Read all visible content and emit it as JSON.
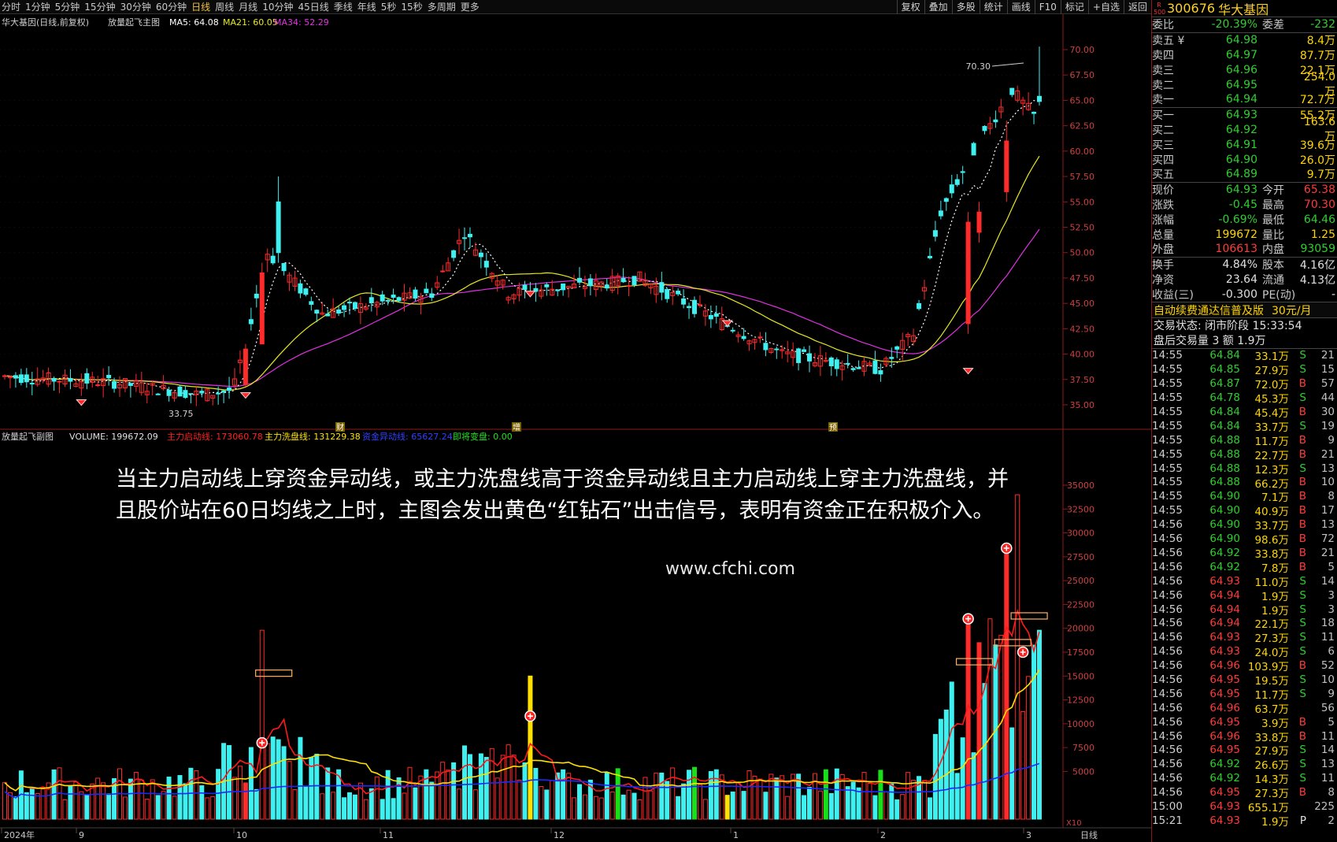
{
  "toolbar": {
    "periods": [
      "分时",
      "1分钟",
      "5分钟",
      "15分钟",
      "30分钟",
      "60分钟",
      "日线",
      "周线",
      "月线",
      "10分钟",
      "45日线",
      "季线",
      "年线",
      "5秒",
      "15秒",
      "多周期",
      "更多"
    ],
    "active": "日线",
    "tools": [
      "复权",
      "叠加",
      "多股",
      "统计",
      "画线",
      "F10",
      "标记",
      "+自选",
      "返回"
    ]
  },
  "main": {
    "title": "华大基因(日线,前复权)",
    "indicator": "放量起飞主图",
    "ma5": "MA5: 64.08",
    "ma21": "MA21: 60.05",
    "ma34": "MA34: 52.29",
    "high_label": "70.30",
    "low_label": "33.75",
    "price_ticks": [
      "70.00",
      "67.50",
      "65.00",
      "62.50",
      "60.00",
      "57.50",
      "55.00",
      "52.50",
      "50.00",
      "47.50",
      "45.00",
      "42.50",
      "40.00",
      "37.50",
      "35.00"
    ],
    "event_marks": [
      "财",
      "增",
      "预"
    ]
  },
  "sub": {
    "name": "放量起飞副图",
    "volume": "VOLUME: 199672.09",
    "line1": "主力启动线: 173060.78",
    "line2": "主力洗盘线: 131229.38",
    "line3": "资金异动线: 65627.24",
    "line4": "即将变盘: 0.00",
    "vol_ticks": [
      "35000",
      "32500",
      "30000",
      "27500",
      "25000",
      "22500",
      "20000",
      "17500",
      "15000",
      "12500",
      "10000",
      "7500",
      "5000"
    ],
    "x10": "X10",
    "caption": "当主力启动线上穿资金异动线，或主力洗盘线高于资金异动线且主力启动线上穿主力洗盘线，并且股价站在60日均线之上时，主图会发出黄色“红钻石”出击信号，表明有资金正在积极介入。",
    "watermark": "www.cfchi.com"
  },
  "xaxis": {
    "labels": [
      "2024年",
      "9",
      "10",
      "11",
      "12",
      "1",
      "2",
      "3"
    ],
    "period": "日线"
  },
  "quote": {
    "r500": "R\n500",
    "code": "300676",
    "name": "华大基因",
    "weibi": {
      "label": "委比",
      "value": "-20.39%",
      "label2": "委差",
      "value2": "-232"
    },
    "asks": [
      {
        "label": "卖五",
        "price": "64.98",
        "vol": "8.4万",
        "mark": "¥"
      },
      {
        "label": "卖四",
        "price": "64.97",
        "vol": "87.7万"
      },
      {
        "label": "卖三",
        "price": "64.96",
        "vol": "22.1万"
      },
      {
        "label": "卖二",
        "price": "64.95",
        "vol": "254.0万"
      },
      {
        "label": "卖一",
        "price": "64.94",
        "vol": "72.7万"
      }
    ],
    "bids": [
      {
        "label": "买一",
        "price": "64.93",
        "vol": "55.2万"
      },
      {
        "label": "买二",
        "price": "64.92",
        "vol": "163.6万"
      },
      {
        "label": "买三",
        "price": "64.91",
        "vol": "39.6万"
      },
      {
        "label": "买四",
        "price": "64.90",
        "vol": "26.0万"
      },
      {
        "label": "买五",
        "price": "64.89",
        "vol": "9.7万"
      }
    ],
    "stats": [
      [
        "现价",
        "64.93",
        "今开",
        "65.38"
      ],
      [
        "涨跌",
        "-0.45",
        "最高",
        "70.30"
      ],
      [
        "涨幅",
        "-0.69%",
        "最低",
        "64.46"
      ],
      [
        "总量",
        "199672",
        "量比",
        "1.25"
      ],
      [
        "外盘",
        "106613",
        "内盘",
        "93059"
      ]
    ],
    "stats2": [
      [
        "换手",
        "4.84%",
        "股本",
        "4.16亿"
      ],
      [
        "净资",
        "23.64",
        "流通",
        "4.13亿"
      ],
      [
        "收益(三)",
        "-0.300",
        "PE(动)",
        "-"
      ]
    ],
    "ad": "自动续费通达信普及版",
    "ad_price": "30元/月",
    "status1": "交易状态: 闭市阶段 15:33:54",
    "status2": "盘后交易量 3 额 1.9万",
    "ticks": [
      [
        "14:55",
        "64.84",
        "33.1万",
        "S",
        "21"
      ],
      [
        "14:55",
        "64.85",
        "27.9万",
        "S",
        "15"
      ],
      [
        "14:55",
        "64.87",
        "72.0万",
        "B",
        "57"
      ],
      [
        "14:55",
        "64.78",
        "45.3万",
        "S",
        "44"
      ],
      [
        "14:55",
        "64.84",
        "45.4万",
        "B",
        "30"
      ],
      [
        "14:55",
        "64.84",
        "33.7万",
        "S",
        "19"
      ],
      [
        "14:55",
        "64.88",
        "11.7万",
        "B",
        "9"
      ],
      [
        "14:55",
        "64.88",
        "22.7万",
        "B",
        "21"
      ],
      [
        "14:55",
        "64.88",
        "12.3万",
        "S",
        "13"
      ],
      [
        "14:55",
        "64.88",
        "66.2万",
        "B",
        "10"
      ],
      [
        "14:55",
        "64.90",
        "7.1万",
        "B",
        "8"
      ],
      [
        "14:55",
        "64.90",
        "40.9万",
        "B",
        "17"
      ],
      [
        "14:56",
        "64.90",
        "33.7万",
        "B",
        "13"
      ],
      [
        "14:56",
        "64.90",
        "98.6万",
        "B",
        "72"
      ],
      [
        "14:56",
        "64.92",
        "33.8万",
        "B",
        "21"
      ],
      [
        "14:56",
        "64.92",
        "7.8万",
        "B",
        "5"
      ],
      [
        "14:56",
        "64.93",
        "11.0万",
        "S",
        "14"
      ],
      [
        "14:56",
        "64.94",
        "1.9万",
        "S",
        "3"
      ],
      [
        "14:56",
        "64.94",
        "1.9万",
        "S",
        "3"
      ],
      [
        "14:56",
        "64.94",
        "22.1万",
        "S",
        "18"
      ],
      [
        "14:56",
        "64.93",
        "27.3万",
        "S",
        "11"
      ],
      [
        "14:56",
        "64.93",
        "24.0万",
        "S",
        "6"
      ],
      [
        "14:56",
        "64.96",
        "103.9万",
        "B",
        "52"
      ],
      [
        "14:56",
        "64.95",
        "19.5万",
        "S",
        "10"
      ],
      [
        "14:56",
        "64.95",
        "11.7万",
        "S",
        "9"
      ],
      [
        "14:56",
        "64.96",
        "63.7万",
        "",
        "56"
      ],
      [
        "14:56",
        "64.95",
        "3.9万",
        "B",
        "5"
      ],
      [
        "14:56",
        "64.96",
        "33.8万",
        "B",
        "11"
      ],
      [
        "14:56",
        "64.95",
        "27.9万",
        "S",
        "14"
      ],
      [
        "14:56",
        "64.92",
        "26.6万",
        "S",
        "13"
      ],
      [
        "14:56",
        "64.92",
        "14.3万",
        "S",
        "11"
      ],
      [
        "14:56",
        "64.95",
        "27.3万",
        "B",
        "8"
      ],
      [
        "15:00",
        "64.93",
        "655.1万",
        "",
        "225"
      ],
      [
        "15:21",
        "64.93",
        "1.9万",
        "P",
        "2"
      ]
    ]
  },
  "colors": {
    "up": "#ff2a2a",
    "down": "#3ff0f0",
    "ma5": "#ffffff",
    "ma21": "#e8e822",
    "ma34": "#e032e0",
    "grid": "#8a1a1a",
    "blue": "#1a2aff",
    "green": "#18e018",
    "yellow": "#ffe000"
  }
}
